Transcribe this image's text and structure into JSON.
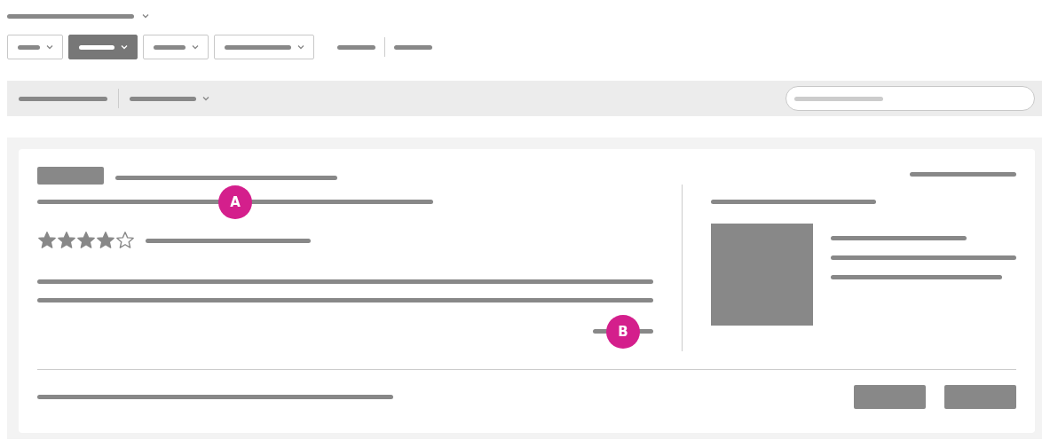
{
  "filters": [
    {
      "selected": false
    },
    {
      "selected": true
    },
    {
      "selected": false
    },
    {
      "selected": false
    }
  ],
  "rating": {
    "stars": 4
  },
  "callouts": [
    {
      "label": "A"
    },
    {
      "label": "B"
    }
  ]
}
